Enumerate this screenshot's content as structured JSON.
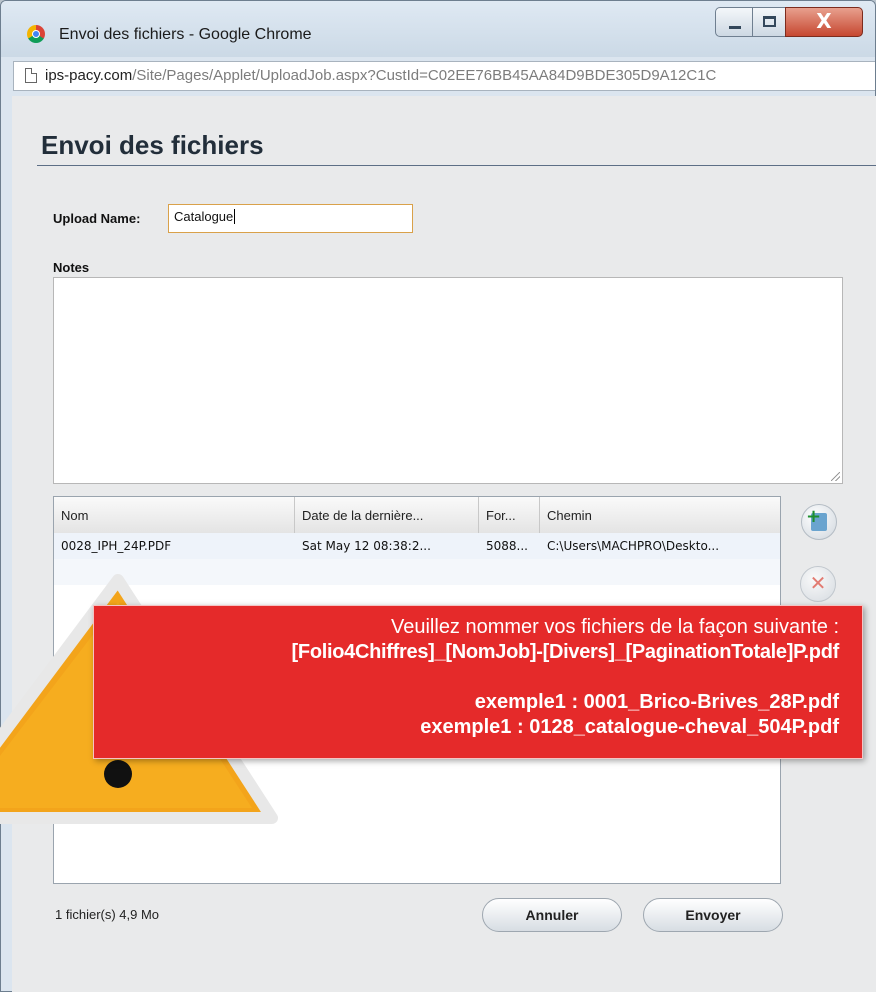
{
  "window": {
    "title": "Envoi des fichiers - Google Chrome",
    "close_glyph": "X"
  },
  "address": {
    "host": "ips-pacy.com",
    "path": "/Site/Pages/Applet/UploadJob.aspx?CustId=C02EE76BB45AA84D9BDE305D9A12C1C"
  },
  "page": {
    "title": "Envoi des fichiers"
  },
  "form": {
    "upload_name_label": "Upload Name:",
    "upload_name_value": "Catalogue",
    "notes_label": "Notes",
    "notes_value": ""
  },
  "table": {
    "columns": [
      "Nom",
      "Date de la dernière...",
      "For...",
      "Chemin"
    ],
    "rows": [
      [
        "0028_IPH_24P.PDF",
        "Sat May 12 08:38:2...",
        "5088...",
        "C:\\Users\\MACHPRO\\Deskto..."
      ]
    ]
  },
  "side_buttons": {
    "add_icon": "add-file-icon",
    "remove_icon": "remove-file-icon",
    "remove_glyph": "✕"
  },
  "footer": {
    "status": "1 fichier(s) 4,9 Mo",
    "cancel_label": "Annuler",
    "send_label": "Envoyer"
  },
  "overlay": {
    "line1": "Veuillez nommer vos fichiers de la façon suivante :",
    "line2": "[Folio4Chiffres]_[NomJob]-[Divers]_[PaginationTotale]P.pdf",
    "line3": "exemple1 : 0001_Brico-Brives_28P.pdf",
    "line4": "exemple1 : 0128_catalogue-cheval_504P.pdf",
    "banner_color": "#e52a2a",
    "warning_color": "#f3a41b"
  }
}
